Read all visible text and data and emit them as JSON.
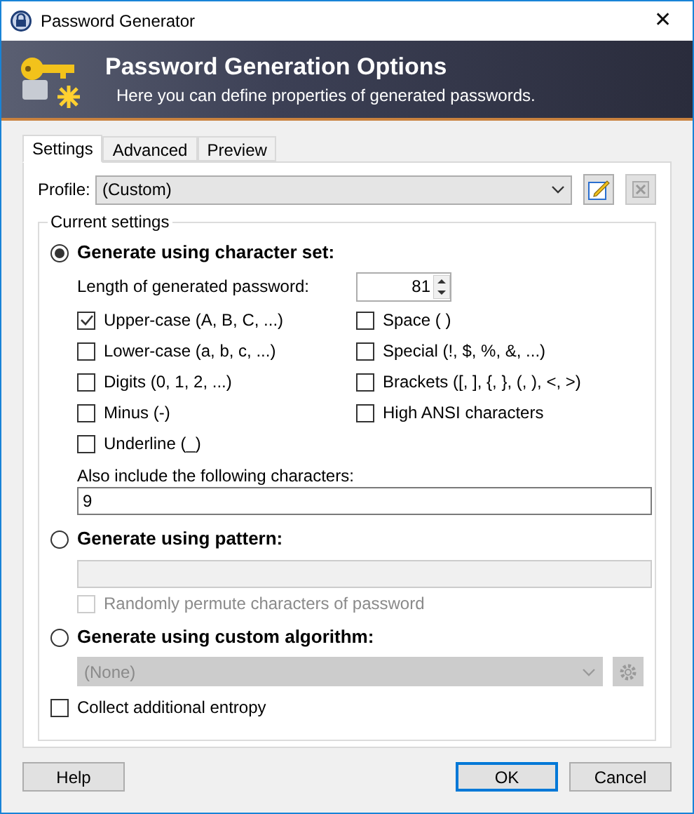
{
  "window": {
    "title": "Password Generator",
    "close": "✕"
  },
  "banner": {
    "title": "Password Generation Options",
    "subtitle": "Here you can define properties of generated passwords."
  },
  "tabs": [
    {
      "label": "Settings",
      "selected": true
    },
    {
      "label": "Advanced",
      "selected": false
    },
    {
      "label": "Preview",
      "selected": false
    }
  ],
  "profile": {
    "label": "Profile:",
    "value": "(Custom)"
  },
  "group": {
    "title": "Current settings"
  },
  "charset_mode": {
    "label": "Generate using character set:",
    "selected": true
  },
  "length": {
    "label": "Length of generated password:",
    "value": "81"
  },
  "options_left": [
    {
      "label": "Upper-case (A, B, C, ...)",
      "checked": true
    },
    {
      "label": "Lower-case (a, b, c, ...)",
      "checked": false
    },
    {
      "label": "Digits (0, 1, 2, ...)",
      "checked": false
    },
    {
      "label": "Minus (-)",
      "checked": false
    },
    {
      "label": "Underline (_)",
      "checked": false
    }
  ],
  "options_right": [
    {
      "label": "Space ( )",
      "checked": false
    },
    {
      "label": "Special (!, $, %, &, ...)",
      "checked": false
    },
    {
      "label": "Brackets ([, ], {, }, (, ), <, >)",
      "checked": false
    },
    {
      "label": "High ANSI characters",
      "checked": false
    }
  ],
  "also_include": {
    "label": "Also include the following characters:",
    "value": "9"
  },
  "pattern_mode": {
    "label": "Generate using pattern:",
    "selected": false
  },
  "pattern_field": {
    "disabled": true
  },
  "permute": {
    "label": "Randomly permute characters of password",
    "checked": false,
    "disabled": true
  },
  "algorithm_mode": {
    "label": "Generate using custom algorithm:",
    "selected": false
  },
  "algorithm": {
    "value": "(None)",
    "disabled": true
  },
  "entropy": {
    "label": "Collect additional entropy",
    "checked": false
  },
  "buttons": [
    {
      "label": "Help",
      "default": false
    },
    {
      "label": "OK",
      "default": true
    },
    {
      "label": "Cancel",
      "default": false
    }
  ]
}
